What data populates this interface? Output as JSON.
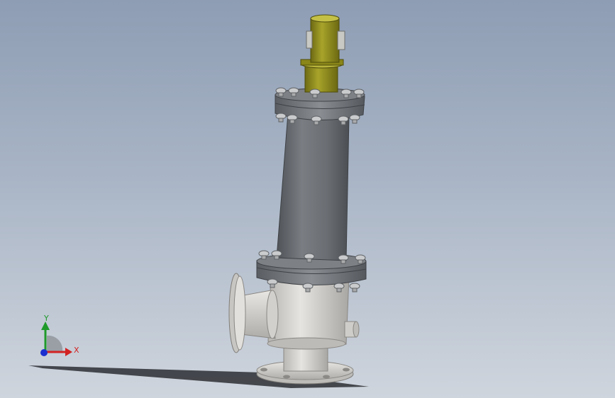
{
  "viewport": {
    "background_top": "#8e9db4",
    "background_bottom": "#cfd5dd"
  },
  "model": {
    "name": "safety-relief-valve",
    "colors": {
      "actuator": "#9a9620",
      "bonnet": "#6f7378",
      "flange": "#6a6e73",
      "body": "#d8d6d2",
      "bolt": "#c9cbcd"
    }
  },
  "triad": {
    "x_label": "X",
    "y_label": "Y",
    "x_color": "#d22222",
    "y_color": "#1f9a2a",
    "z_color": "#1b2fd0"
  }
}
